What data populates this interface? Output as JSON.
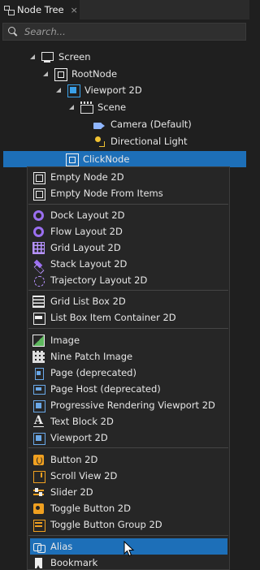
{
  "panel": {
    "tab_title": "Node Tree",
    "tab_close": "×",
    "search_placeholder": "Search..."
  },
  "tree": [
    {
      "label": "Screen",
      "icon": "screen-icon"
    },
    {
      "label": "RootNode",
      "icon": "node-icon"
    },
    {
      "label": "Viewport 2D",
      "icon": "viewport-icon"
    },
    {
      "label": "Scene",
      "icon": "scene-icon"
    },
    {
      "label": "Camera (Default)",
      "icon": "camera-icon"
    },
    {
      "label": "Directional Light",
      "icon": "light-icon"
    },
    {
      "label": "ClickNode",
      "icon": "node-icon",
      "selected": true
    }
  ],
  "menu": [
    {
      "label": "Empty Node 2D",
      "icon": "empty-node-icon"
    },
    {
      "label": "Empty Node From Items",
      "icon": "empty-node-items-icon"
    },
    {
      "label": "Dock Layout 2D",
      "icon": "dock-layout-icon"
    },
    {
      "label": "Flow Layout 2D",
      "icon": "flow-layout-icon"
    },
    {
      "label": "Grid Layout 2D",
      "icon": "grid-layout-icon"
    },
    {
      "label": "Stack Layout 2D",
      "icon": "stack-layout-icon"
    },
    {
      "label": "Trajectory Layout 2D",
      "icon": "trajectory-layout-icon"
    },
    {
      "label": "Grid List Box 2D",
      "icon": "grid-list-box-icon"
    },
    {
      "label": "List Box Item Container 2D",
      "icon": "list-box-item-icon"
    },
    {
      "label": "Image",
      "icon": "image-icon"
    },
    {
      "label": "Nine Patch Image",
      "icon": "nine-patch-icon"
    },
    {
      "label": "Page (deprecated)",
      "icon": "page-icon"
    },
    {
      "label": "Page Host (deprecated)",
      "icon": "page-host-icon"
    },
    {
      "label": "Progressive Rendering Viewport 2D",
      "icon": "progressive-rendering-icon"
    },
    {
      "label": "Text Block 2D",
      "icon": "text-block-icon"
    },
    {
      "label": "Viewport 2D",
      "icon": "viewport-2d-icon"
    },
    {
      "label": "Button 2D",
      "icon": "button-icon"
    },
    {
      "label": "Scroll View 2D",
      "icon": "scroll-view-icon"
    },
    {
      "label": "Slider 2D",
      "icon": "slider-icon"
    },
    {
      "label": "Toggle Button 2D",
      "icon": "toggle-button-icon"
    },
    {
      "label": "Toggle Button Group 2D",
      "icon": "toggle-button-group-icon"
    },
    {
      "label": "Alias",
      "icon": "alias-icon",
      "highlighted": true
    },
    {
      "label": "Bookmark",
      "icon": "bookmark-icon"
    }
  ],
  "colors": {
    "selection": "#1d6fb8",
    "background": "#1f1f1f",
    "menu_background": "#262626",
    "layout_purple": "#9b6ff0",
    "control_orange": "#f0a020",
    "viewport_blue": "#3aa0e8"
  }
}
